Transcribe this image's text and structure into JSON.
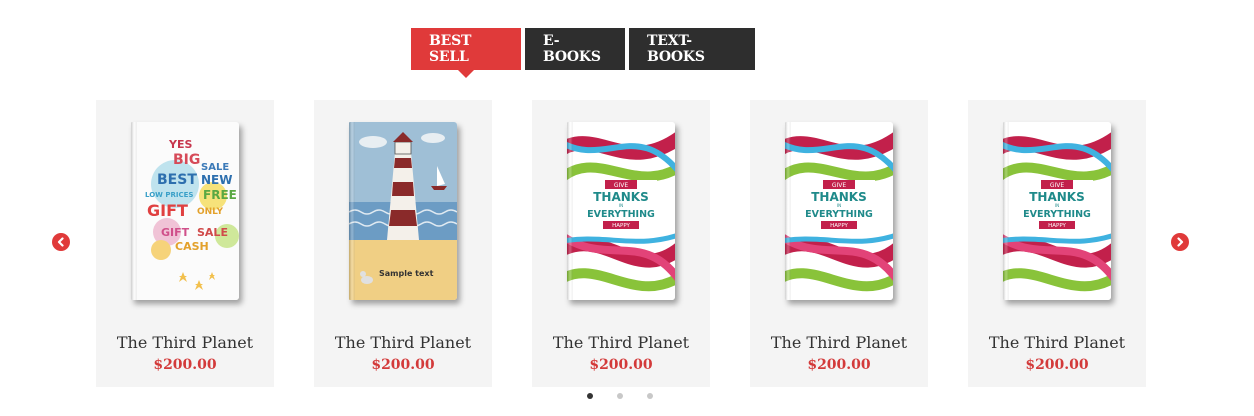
{
  "tabs": [
    {
      "label": "BEST SELL",
      "active": true
    },
    {
      "label": "E-BOOKS",
      "active": false
    },
    {
      "label": "TEXT-BOOKS",
      "active": false
    }
  ],
  "colors": {
    "accent": "#e03a3a",
    "dark": "#2e2e2e",
    "price": "#d33a3a",
    "card_bg": "#f4f4f4"
  },
  "products": [
    {
      "title": "The Third Planet",
      "price": "$200.00",
      "cover": "sale-cover"
    },
    {
      "title": "The Third Planet",
      "price": "$200.00",
      "cover": "lighthouse-cover"
    },
    {
      "title": "The Third Planet",
      "price": "$200.00",
      "cover": "give-thanks-cover"
    },
    {
      "title": "The Third Planet",
      "price": "$200.00",
      "cover": "give-thanks-cover"
    },
    {
      "title": "The Third Planet",
      "price": "$200.00",
      "cover": "give-thanks-cover"
    }
  ],
  "covers": {
    "sale": [
      "YES",
      "BIG",
      "SALE",
      "BEST",
      "NEW",
      "LOW PRICES",
      "FREE",
      "GIFT",
      "ONLY",
      "GIFT",
      "SALE",
      "CASH"
    ],
    "lighthouse": {
      "caption": "Sample text"
    },
    "thanks": {
      "give": "GIVE",
      "thanks": "THANKS",
      "in": "IN",
      "everything": "EVERYTHING",
      "happy": "HAPPY"
    }
  },
  "carousel": {
    "prev_icon": "chevron-left-icon",
    "next_icon": "chevron-right-icon",
    "page_count": 3,
    "active_page": 1
  }
}
